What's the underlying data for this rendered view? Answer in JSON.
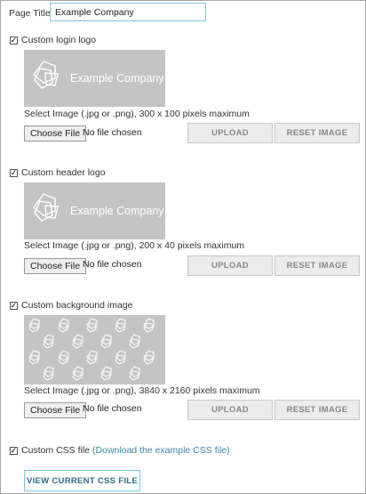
{
  "page_title": {
    "label": "Page Title",
    "value": "Example Company"
  },
  "sections": [
    {
      "checkbox_label": "Custom login logo",
      "checked": true,
      "preview_text": "Example Company",
      "hint": "Select Image (.jpg or .png), 300 x 100 pixels maximum",
      "choose_label": "Choose File",
      "no_file": "No file chosen",
      "upload": "UPLOAD",
      "reset": "RESET IMAGE"
    },
    {
      "checkbox_label": "Custom header logo",
      "checked": true,
      "preview_text": "Example Company",
      "hint": "Select Image (.jpg or .png), 200 x 40 pixels maximum",
      "choose_label": "Choose File",
      "no_file": "No file chosen",
      "upload": "UPLOAD",
      "reset": "RESET IMAGE"
    },
    {
      "checkbox_label": "Custom background image",
      "checked": true,
      "hint": "Select Image (.jpg or .png), 3840 x 2160 pixels maximum",
      "choose_label": "Choose File",
      "no_file": "No file chosen",
      "upload": "UPLOAD",
      "reset": "RESET IMAGE"
    }
  ],
  "css": {
    "checkbox_label": "Custom CSS file",
    "checked": true,
    "link_open": "(",
    "link_text": "Download the example CSS file",
    "link_close": ")",
    "view_button": "VIEW CURRENT CSS FILE"
  },
  "colors": {
    "accent": "#7fc6d6",
    "link": "#3a88a8",
    "preview_bg": "#c4c4c4",
    "button_bg": "#ececec"
  },
  "icons": {
    "checkbox": "check-mark",
    "logo": "overlapping-pentagons-logo"
  }
}
